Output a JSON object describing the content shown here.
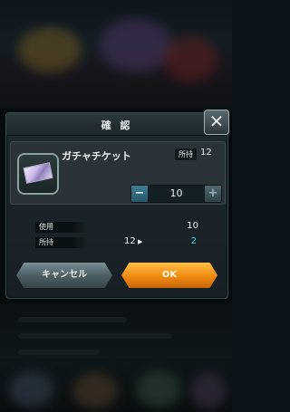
{
  "dialog": {
    "title": "確 認",
    "close_symbol": "✕",
    "item": {
      "name": "ガチャチケット",
      "owned_label": "所持",
      "owned_value": "12",
      "icon": "ticket-icon"
    },
    "stepper": {
      "minus": "−",
      "quantity": "10",
      "plus": "+"
    },
    "stats": {
      "use_label": "使用",
      "use_value": "10",
      "owned_label": "所持",
      "owned_from": "12",
      "arrow": "▶",
      "owned_to": "2"
    },
    "buttons": {
      "cancel": "キャンセル",
      "ok": "OK"
    }
  },
  "colors": {
    "ok_button": "#f08a12",
    "cancel_button": "#4e5f66",
    "accent_value": "#4ad1e0"
  }
}
